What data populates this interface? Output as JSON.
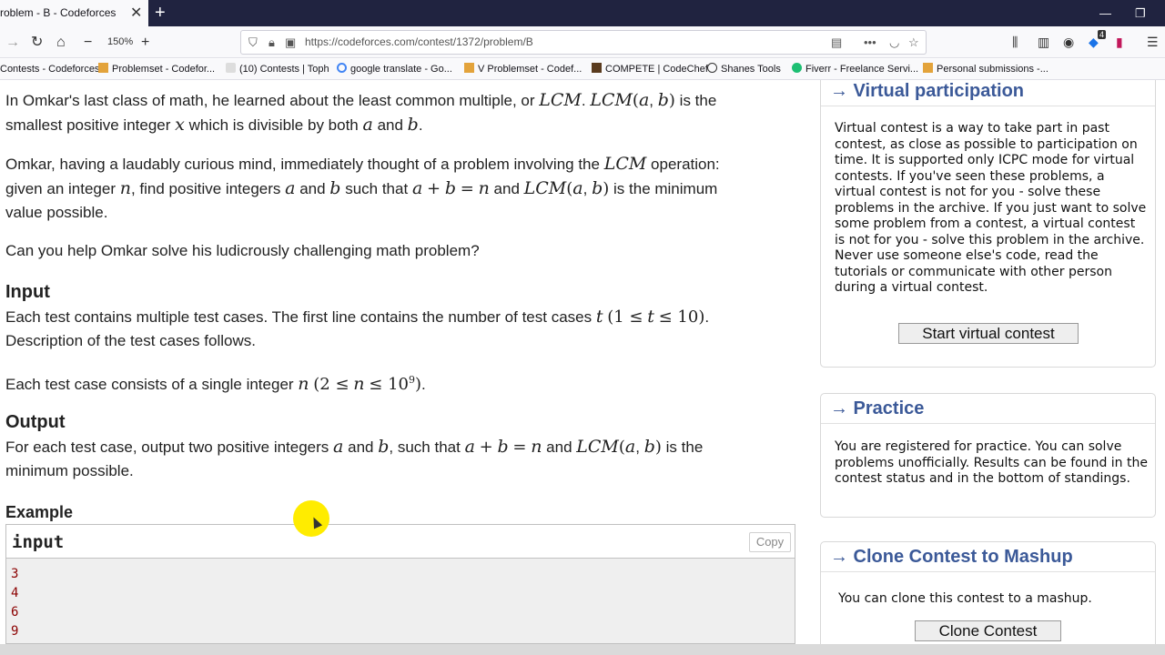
{
  "browser": {
    "tab_title": "roblem - B - Codeforces",
    "tab_close": "✕",
    "new_tab": "+",
    "zoom": "150%",
    "url": "https://codeforces.com/contest/1372/problem/B",
    "bookmarks": [
      "Contests - Codeforces",
      "Problemset - Codefor...",
      "(10) Contests | Toph",
      "google translate - Go...",
      "V Problemset - Codef...",
      "COMPETE | CodeChef",
      "Shanes Tools",
      "Fiverr - Freelance Servi...",
      "Personal submissions -..."
    ],
    "badge": "4"
  },
  "problem": {
    "p1a": "In Omkar's last class of math, he learned about the least common multiple, or",
    "p1b": "is the",
    "p1c": "smallest positive integer",
    "p1d": "which is divisible by both",
    "p1e": "and",
    "p2a": "Omkar, having a laudably curious mind, immediately thought of a problem involving the",
    "p2b": "operation:",
    "p2c": "given an integer",
    "p2d": ", find positive integers",
    "p2e": "and",
    "p2f": "such that",
    "p2g": "and",
    "p2h": "is the minimum",
    "p2i": "value possible.",
    "p3": "Can you help Omkar solve his ludicrously challenging math problem?",
    "input_h": "Input",
    "in1a": "Each test contains multiple test cases. The first line contains the number of test cases",
    "in1b": "Description of the test cases follows.",
    "in2a": "Each test case consists of a single integer",
    "output_h": "Output",
    "out1a": "For each test case, output two positive integers",
    "out1b": "and",
    "out1c": ", such that",
    "out1d": "and",
    "out1e": "is the",
    "out1f": "minimum possible.",
    "example_h": "Example",
    "example_title": "input",
    "copy": "Copy",
    "example_lines": [
      "3",
      "4",
      "6",
      "9"
    ]
  },
  "sidebar": {
    "virtual": {
      "title": "→ Virtual participation",
      "body": "Virtual contest is a way to take part in past contest, as close as possible to participation on time. It is supported only ICPC mode for virtual contests. If you've seen these problems, a virtual contest is not for you - solve these problems in the archive. If you just want to solve some problem from a contest, a virtual contest is not for you - solve this problem in the archive. Never use someone else's code, read the tutorials or communicate with other person during a virtual contest.",
      "button": "Start virtual contest"
    },
    "practice": {
      "title": "→ Practice",
      "body": "You are registered for practice. You can solve problems unofficially. Results can be found in the contest status and in the bottom of standings."
    },
    "clone": {
      "title": "→ Clone Contest to Mashup",
      "body": "You can clone this contest to a mashup.",
      "button": "Clone Contest"
    }
  },
  "colors": {
    "accent": "#3b5998",
    "highlight": "#ffec00",
    "example_text": "#8b0000"
  }
}
